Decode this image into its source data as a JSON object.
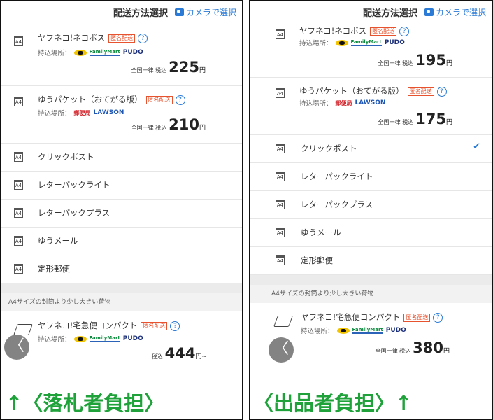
{
  "header": {
    "title": "配送方法選択",
    "camera_label": "カメラで選択"
  },
  "left": {
    "methods": [
      {
        "icon": "A4",
        "name": "ヤフネコ!ネコポス",
        "tag": "匿名配送",
        "dropoff": "持込場所：",
        "price_label": "全国一律 税込",
        "price": "225",
        "yen": "円"
      },
      {
        "icon": "A4",
        "name": "ゆうパケット（おてがる版）",
        "tag": "匿名配送",
        "dropoff": "持込場所：",
        "price_label": "全国一律 税込",
        "price": "210",
        "yen": "円"
      }
    ],
    "simple": [
      "クリックポスト",
      "レターパックライト",
      "レターパックプラス",
      "ゆうメール",
      "定形郵便"
    ],
    "section": "A4サイズの封筒より少し大きい荷物",
    "compact": {
      "name": "ヤフネコ!宅急便コンパクト",
      "tag": "匿名配送",
      "dropoff": "持込場所：",
      "price_label": "税込",
      "price": "444",
      "yen": "円~"
    },
    "caption": "↑〈落札者負担〉"
  },
  "right": {
    "methods": [
      {
        "icon": "A4",
        "name": "ヤフネコ!ネコポス",
        "tag": "匿名配送",
        "dropoff": "持込場所：",
        "price_label": "全国一律 税込",
        "price": "195",
        "yen": "円"
      },
      {
        "icon": "A4",
        "name": "ゆうパケット（おてがる版）",
        "tag": "匿名配送",
        "dropoff": "持込場所：",
        "price_label": "全国一律 税込",
        "price": "175",
        "yen": "円"
      }
    ],
    "simple": [
      "クリックポスト",
      "レターパックライト",
      "レターパックプラス",
      "ゆうメール",
      "定形郵便"
    ],
    "selected_index": 0,
    "section": "A4サイズの封筒より少し大きい荷物",
    "compact": {
      "name": "ヤフネコ!宅急便コンパクト",
      "tag": "匿名配送",
      "dropoff": "持込場所：",
      "price_label": "全国一律 税込",
      "price": "380",
      "yen": "円"
    },
    "caption": "〈出品者負担〉↑"
  },
  "logos": {
    "kuroneko": "kuroneko-logo",
    "familymart": "FamilyMart",
    "pudo": "PUDO",
    "japanpost": "郵便局",
    "lawson": "LAWSON"
  },
  "colors": {
    "accent": "#2b7bd6",
    "tag": "#e8532f",
    "caption": "#1fa23a"
  },
  "misc": {
    "a4_icon": "A4",
    "help": "?",
    "check": "✔",
    "back": "〈"
  }
}
